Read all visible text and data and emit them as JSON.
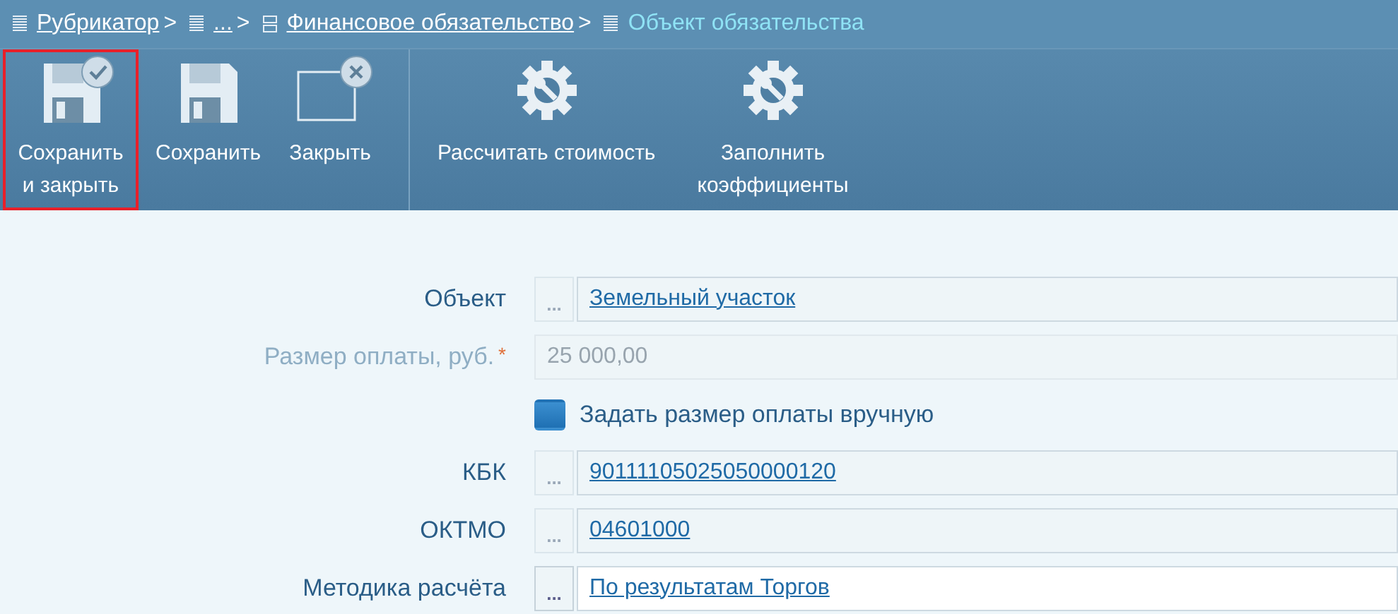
{
  "breadcrumbs": [
    {
      "label": "Рубрикатор",
      "current": false,
      "separator": ">"
    },
    {
      "label": "...",
      "current": false,
      "separator": ">"
    },
    {
      "label": "Финансовое обязательство",
      "current": false,
      "separator": ">"
    },
    {
      "label": "Объект обязательства",
      "current": true
    }
  ],
  "toolbar": [
    {
      "label": "Сохранить и закрыть",
      "selected": true
    },
    {
      "label": "Сохранить",
      "selected": false
    },
    {
      "label": "Закрыть",
      "selected": false
    },
    {
      "label": "Рассчитать стоимость",
      "selected": false
    },
    {
      "label": "Заполнить коэффициенты",
      "selected": false
    }
  ],
  "form": [
    {
      "kind": "lookup",
      "label": "Объект",
      "picker": "...",
      "value": "Земельный участок",
      "focused": false
    },
    {
      "kind": "number",
      "label": "Размер оплаты, руб.",
      "required": "*",
      "disabled": true,
      "value": "25 000,00"
    },
    {
      "kind": "checkbox",
      "label": "Задать размер оплаты вручную",
      "checked": false
    },
    {
      "kind": "lookup",
      "label": "КБК",
      "picker": "...",
      "value": "90111105025050000120",
      "focused": false
    },
    {
      "kind": "lookup",
      "label": "ОКТМО",
      "picker": "...",
      "value": "04601000",
      "focused": false
    },
    {
      "kind": "lookup",
      "label": "Методика расчёта",
      "picker": "...",
      "value": "По результатам Торгов",
      "focused": true
    }
  ]
}
